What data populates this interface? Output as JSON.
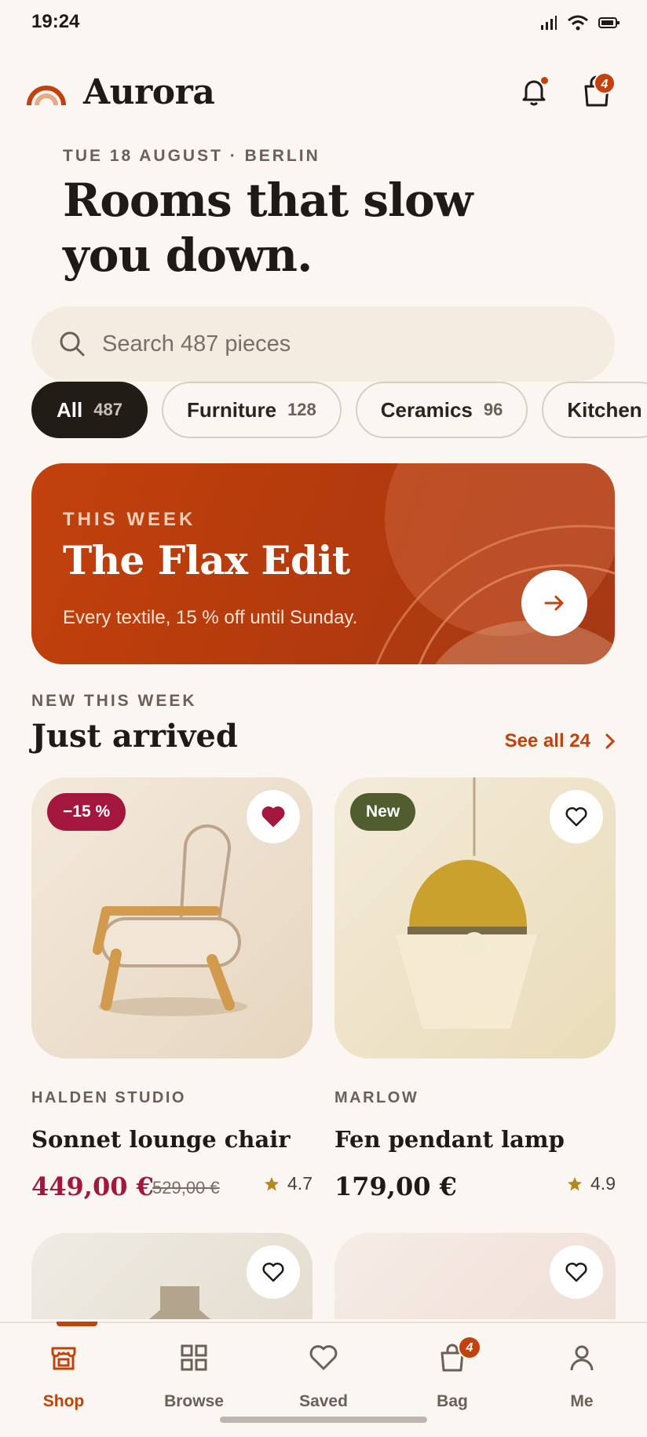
{
  "status": {
    "time": "19:24"
  },
  "header": {
    "brand": "Aurora",
    "bag_count": "4",
    "accent": "#c2410c"
  },
  "hero": {
    "dateline": "TUE 18 AUGUST · BERLIN",
    "headline": "Rooms that slow you down."
  },
  "search": {
    "placeholder": "Search 487 pieces"
  },
  "chips": [
    {
      "label": "All",
      "count": "487"
    },
    {
      "label": "Furniture",
      "count": "128"
    },
    {
      "label": "Ceramics",
      "count": "96"
    },
    {
      "label": "Kitchen",
      "count": ""
    }
  ],
  "promo": {
    "kicker": "THIS WEEK",
    "title": "The Flax Edit",
    "subtitle": "Every textile, 15 % off until Sunday."
  },
  "section": {
    "kicker": "NEW THIS WEEK",
    "title": "Just arrived",
    "see_all": "See all 24"
  },
  "products": [
    {
      "badge": "−15 %",
      "brand": "HALDEN STUDIO",
      "name": "Sonnet lounge chair",
      "price": "449,00 €",
      "old_price": "529,00 €",
      "rating": "4.7",
      "favorited": true
    },
    {
      "badge": "New",
      "brand": "MARLOW",
      "name": "Fen pendant lamp",
      "price": "179,00 €",
      "rating": "4.9",
      "favorited": false
    }
  ],
  "tabs": [
    {
      "label": "Shop",
      "icon": "store-icon"
    },
    {
      "label": "Browse",
      "icon": "grid-icon"
    },
    {
      "label": "Saved",
      "icon": "heart-icon"
    },
    {
      "label": "Bag",
      "icon": "bag-icon",
      "badge": "4"
    },
    {
      "label": "Me",
      "icon": "person-icon"
    }
  ]
}
